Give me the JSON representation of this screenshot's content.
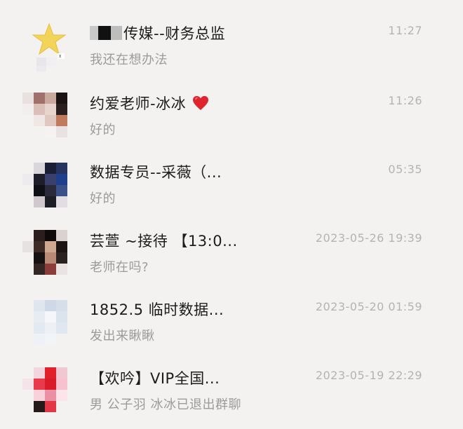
{
  "chats": [
    {
      "name_prefix_redacted": true,
      "name": "传媒--财务总监",
      "preview": "我还在想办法",
      "time": "11:27",
      "avatar": "star-avatar"
    },
    {
      "name": "约爱老师-冰冰",
      "name_suffix_icon": "red-heart-icon",
      "preview": "好的",
      "time": "11:26",
      "avatar": "pixelated-portrait"
    },
    {
      "name": "数据专员--采薇（...",
      "preview": "好的",
      "time": "05:35",
      "avatar": "pixelated-portrait"
    },
    {
      "name": "芸萱  ~接待  【13:0...",
      "preview": "老师在吗?",
      "time": "2023-05-26 19:39",
      "avatar": "pixelated-portrait"
    },
    {
      "name": "1852.5 临时数据...",
      "preview": "发出来瞅瞅",
      "time": "2023-05-20 01:59",
      "avatar": "pixelated-portrait"
    },
    {
      "name": "【欢吟】VIP全国...",
      "preview": "男 公子羽 冰冰已退出群聊",
      "time": "2023-05-19 22:29",
      "avatar": "pixelated-group"
    }
  ],
  "colors": {
    "background": "#f3f2f0",
    "name_text": "#1c1c1c",
    "preview_text": "#9b9b9b",
    "time_text": "#b3b3b3",
    "heart": "#e0242e"
  }
}
